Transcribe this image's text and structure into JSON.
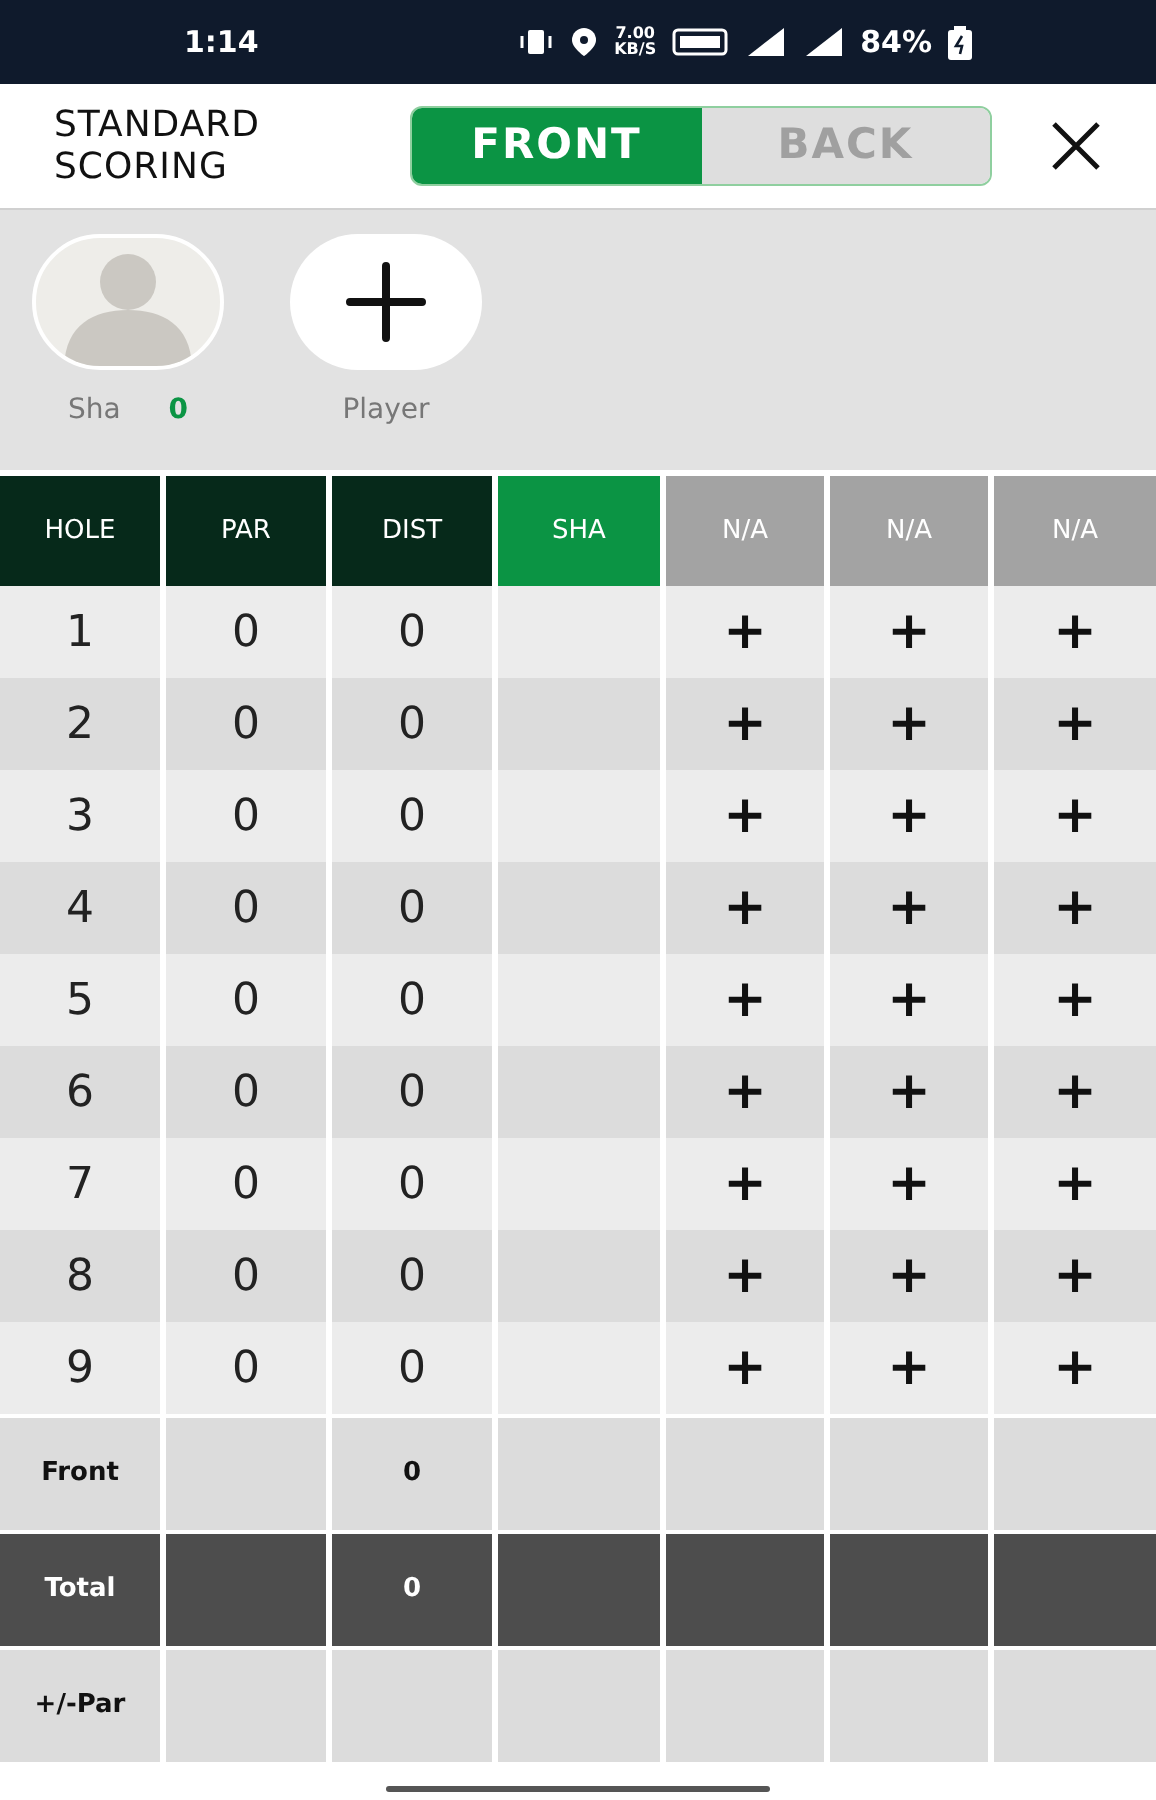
{
  "status_bar": {
    "time": "1:14",
    "speed": [
      "7.00",
      "KB/S"
    ],
    "battery": "84%"
  },
  "header": {
    "title": [
      "STANDARD",
      "SCORING"
    ],
    "segments": [
      {
        "label": "FRONT",
        "selected": true
      },
      {
        "label": "BACK",
        "selected": false
      }
    ]
  },
  "players": [
    {
      "kind": "player",
      "name": "Sha",
      "score": "0"
    },
    {
      "kind": "add",
      "label": "Player"
    }
  ],
  "table": {
    "columns": [
      {
        "label": "HOLE",
        "kind": "fixed"
      },
      {
        "label": "PAR",
        "kind": "fixed"
      },
      {
        "label": "DIST",
        "kind": "fixed"
      },
      {
        "label": "SHA",
        "kind": "player"
      },
      {
        "label": "N/A",
        "kind": "empty"
      },
      {
        "label": "N/A",
        "kind": "empty"
      },
      {
        "label": "N/A",
        "kind": "empty"
      }
    ],
    "rows": [
      {
        "cells": [
          "1",
          "0",
          "0",
          "",
          "+",
          "+",
          "+"
        ]
      },
      {
        "cells": [
          "2",
          "0",
          "0",
          "",
          "+",
          "+",
          "+"
        ]
      },
      {
        "cells": [
          "3",
          "0",
          "0",
          "",
          "+",
          "+",
          "+"
        ]
      },
      {
        "cells": [
          "4",
          "0",
          "0",
          "",
          "+",
          "+",
          "+"
        ]
      },
      {
        "cells": [
          "5",
          "0",
          "0",
          "",
          "+",
          "+",
          "+"
        ]
      },
      {
        "cells": [
          "6",
          "0",
          "0",
          "",
          "+",
          "+",
          "+"
        ]
      },
      {
        "cells": [
          "7",
          "0",
          "0",
          "",
          "+",
          "+",
          "+"
        ]
      },
      {
        "cells": [
          "8",
          "0",
          "0",
          "",
          "+",
          "+",
          "+"
        ]
      },
      {
        "cells": [
          "9",
          "0",
          "0",
          "",
          "+",
          "+",
          "+"
        ]
      }
    ],
    "summary": [
      {
        "kind": "light",
        "cells": [
          "Front",
          "",
          "0",
          "",
          "",
          "",
          ""
        ]
      },
      {
        "kind": "dark",
        "cells": [
          "Total",
          "",
          "0",
          "",
          "",
          "",
          ""
        ]
      },
      {
        "kind": "light",
        "cells": [
          "+/-Par",
          "",
          "",
          "",
          "",
          "",
          ""
        ]
      }
    ]
  }
}
